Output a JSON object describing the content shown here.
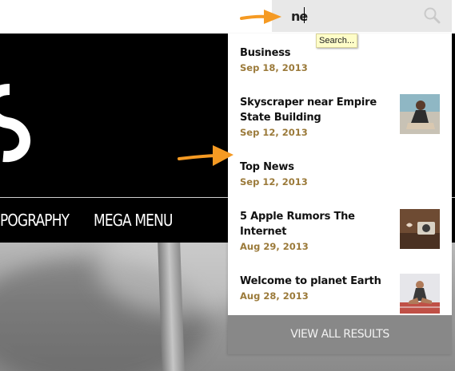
{
  "nav": {
    "items": [
      "POGRAPHY",
      "MEGA MENU"
    ]
  },
  "search": {
    "value": "ne",
    "tooltip": "Search..."
  },
  "results": [
    {
      "title": "Business",
      "date": "Sep 18, 2013",
      "thumbnail": null
    },
    {
      "title": "Skyscraper near Empire State Building",
      "title_lines": [
        "Skyscraper near Empire",
        "State Building"
      ],
      "date": "Sep 12, 2013",
      "thumbnail": "woman-sitting-photo"
    },
    {
      "title": "Top News",
      "date": "Sep 12, 2013",
      "thumbnail": null
    },
    {
      "title": "5 Apple Rumors The Internet",
      "title_lines": [
        "5 Apple Rumors The",
        "Internet"
      ],
      "date": "Aug 29, 2013",
      "thumbnail": "camera-photo"
    },
    {
      "title": "Welcome to planet Earth",
      "date": "Aug 28, 2013",
      "thumbnail": "sprinter-photo"
    }
  ],
  "view_all_label": "VIEW ALL RESULTS",
  "colors": {
    "date": "#9b7a3a",
    "annotation_arrow": "#f59a23",
    "view_all_bg": "#888888",
    "search_bg": "#e8e8e8"
  }
}
